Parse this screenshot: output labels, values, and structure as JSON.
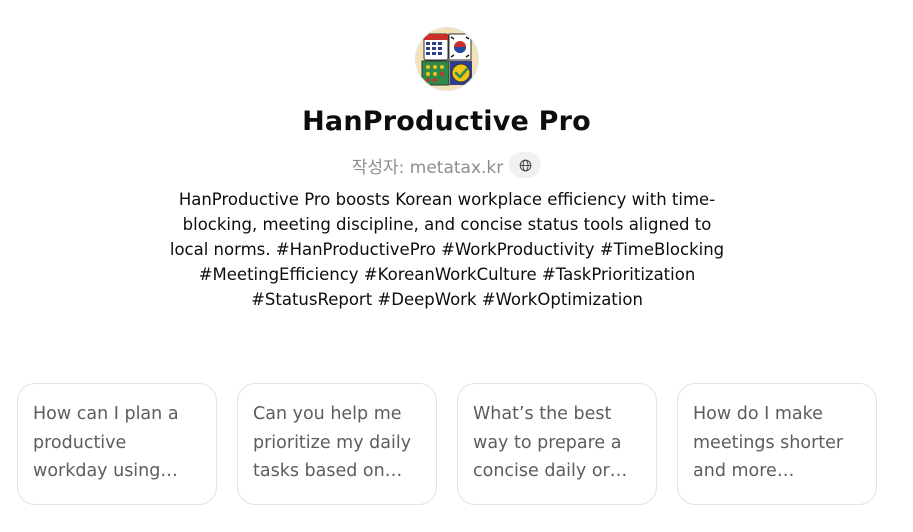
{
  "gpt": {
    "title": "HanProductive Pro",
    "author": "작성자: metatax.kr",
    "globe_icon": "globe-icon",
    "description": "HanProductive Pro boosts Korean workplace efficiency with time-blocking, meeting discipline, and concise status tools aligned to local norms. #HanProductivePro #WorkProductivity #TimeBlocking #MeetingEfficiency #KoreanWorkCulture #TaskPrioritization #StatusReport #DeepWork #WorkOptimization"
  },
  "starters": [
    {
      "text": "How can I plan a productive workday using time-blocking?"
    },
    {
      "text": "Can you help me prioritize my daily tasks based on urgency?"
    },
    {
      "text": "What’s the best way to prepare a concise daily or weekly status report?"
    },
    {
      "text": "How do I make meetings shorter and more effective?"
    }
  ],
  "colors": {
    "title": "#0d0d0d",
    "muted": "#8e8e8e",
    "card_border": "#e3e3e3",
    "card_text": "#5d5d5d"
  }
}
